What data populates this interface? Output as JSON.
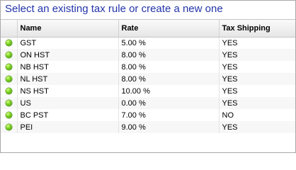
{
  "title": "Select an existing tax rule or create a new one",
  "columns": {
    "status": "",
    "name": "Name",
    "rate": "Rate",
    "tax_shipping": "Tax Shipping"
  },
  "status_color": "#7ed321",
  "rows": [
    {
      "name": "GST",
      "rate": "5.00 %",
      "tax_shipping": "YES"
    },
    {
      "name": "ON HST",
      "rate": "8.00 %",
      "tax_shipping": "YES"
    },
    {
      "name": "NB HST",
      "rate": "8.00 %",
      "tax_shipping": "YES"
    },
    {
      "name": "NL HST",
      "rate": "8.00 %",
      "tax_shipping": "YES"
    },
    {
      "name": "NS HST",
      "rate": "10.00 %",
      "tax_shipping": "YES"
    },
    {
      "name": "US",
      "rate": "0.00 %",
      "tax_shipping": "YES"
    },
    {
      "name": "BC PST",
      "rate": "7.00 %",
      "tax_shipping": "NO"
    },
    {
      "name": "PEI",
      "rate": "9.00 %",
      "tax_shipping": "YES"
    }
  ]
}
